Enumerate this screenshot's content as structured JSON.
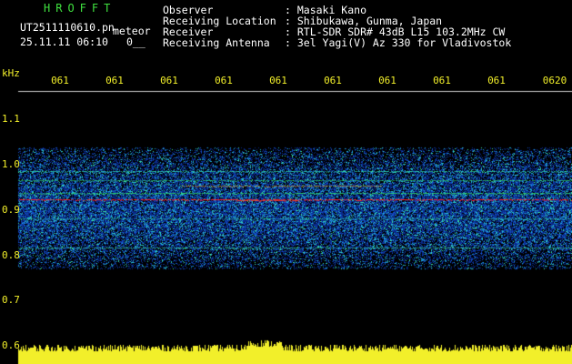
{
  "header": {
    "brand": "HROFFT",
    "filename": "UT2511110610.pn",
    "tag": "meteor",
    "date": "25.11.11 06:10",
    "counter": "0__",
    "labels": [
      "Observer",
      "Receiving Location",
      "Receiver",
      "Receiving Antenna"
    ],
    "values": [
      ": Masaki Kano",
      ": Shibukawa, Gunma, Japan",
      ": RTL-SDR SDR# 43dB L15 103.2MHz CW",
      ": 3el Yagi(V) Az 330 for Vladivostok"
    ]
  },
  "axis": {
    "unit": "kHz",
    "y_ticks": [
      "1.1",
      "1.0",
      "0.9",
      "0.8",
      "0.7",
      "0.6"
    ],
    "x_ticks": [
      "061",
      "061",
      "061",
      "061",
      "061",
      "061",
      "061",
      "061",
      "061",
      "0620"
    ]
  },
  "colors": {
    "text": "#ffffff",
    "brand": "#3fe03f",
    "axis": "#f2ef2a",
    "signal": "#ff2020",
    "noise_low": "#0a2a8a",
    "noise_high": "#1fb8d8"
  }
}
